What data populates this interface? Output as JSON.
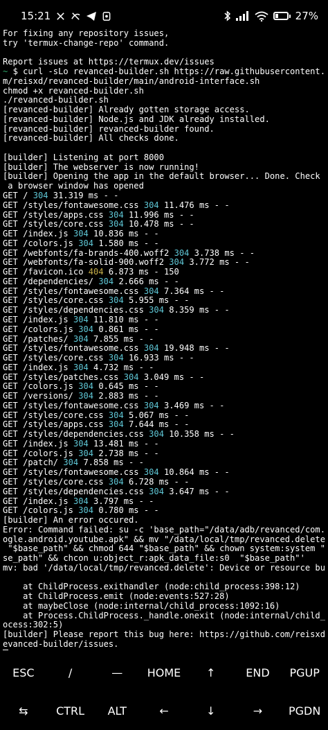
{
  "status_bar": {
    "time": "15:21",
    "battery_percent": "27%",
    "battery_level": 0.27
  },
  "terminal": {
    "lines": [
      [
        {
          "t": "For fixing any repository issues,"
        }
      ],
      [
        {
          "t": "try 'termux-change-repo' command."
        }
      ],
      [
        {
          "t": ""
        }
      ],
      [
        {
          "t": "Report issues at https://termux.dev/issues"
        }
      ],
      [
        {
          "t": "~ ",
          "c": "green"
        },
        {
          "t": "$ curl -sLo revanced-builder.sh https://raw.githubusercontent.co"
        }
      ],
      [
        {
          "t": "m/reisxd/revanced-builder/main/android-interface.sh"
        }
      ],
      [
        {
          "t": "chmod +x revanced-builder.sh"
        }
      ],
      [
        {
          "t": "./revanced-builder.sh"
        }
      ],
      [
        {
          "t": "[revanced-builder] Already gotten storage access."
        }
      ],
      [
        {
          "t": "[revanced-builder] Node.js and JDK already installed."
        }
      ],
      [
        {
          "t": "[revanced-builder] revanced-builder found."
        }
      ],
      [
        {
          "t": "[revanced-builder] All checks done."
        }
      ],
      [
        {
          "t": ""
        }
      ],
      [
        {
          "t": "[builder] Listening at port 8000"
        }
      ],
      [
        {
          "t": "[builder] The webserver is now running!"
        }
      ],
      [
        {
          "t": "[builder] Opening the app in the default browser... Done. Check if"
        }
      ],
      [
        {
          "t": " a browser window has opened"
        }
      ],
      [
        {
          "t": "GET / "
        },
        {
          "t": "304",
          "c": "cyan"
        },
        {
          "t": " 31.319 ms - -"
        }
      ],
      [
        {
          "t": "GET /styles/fontawesome.css "
        },
        {
          "t": "304",
          "c": "cyan"
        },
        {
          "t": " 11.476 ms - -"
        }
      ],
      [
        {
          "t": "GET /styles/apps.css "
        },
        {
          "t": "304",
          "c": "cyan"
        },
        {
          "t": " 11.996 ms - -"
        }
      ],
      [
        {
          "t": "GET /styles/core.css "
        },
        {
          "t": "304",
          "c": "cyan"
        },
        {
          "t": " 10.478 ms - -"
        }
      ],
      [
        {
          "t": "GET /index.js "
        },
        {
          "t": "304",
          "c": "cyan"
        },
        {
          "t": " 10.836 ms - -"
        }
      ],
      [
        {
          "t": "GET /colors.js "
        },
        {
          "t": "304",
          "c": "cyan"
        },
        {
          "t": " 1.580 ms - -"
        }
      ],
      [
        {
          "t": "GET /webfonts/fa-brands-400.woff2 "
        },
        {
          "t": "304",
          "c": "cyan"
        },
        {
          "t": " 3.738 ms - -"
        }
      ],
      [
        {
          "t": "GET /webfonts/fa-solid-900.woff2 "
        },
        {
          "t": "304",
          "c": "cyan"
        },
        {
          "t": " 3.772 ms - -"
        }
      ],
      [
        {
          "t": "GET /favicon.ico "
        },
        {
          "t": "404",
          "c": "yellow"
        },
        {
          "t": " 6.873 ms - 150"
        }
      ],
      [
        {
          "t": "GET /dependencies/ "
        },
        {
          "t": "304",
          "c": "cyan"
        },
        {
          "t": " 2.666 ms - -"
        }
      ],
      [
        {
          "t": "GET /styles/fontawesome.css "
        },
        {
          "t": "304",
          "c": "cyan"
        },
        {
          "t": " 7.364 ms - -"
        }
      ],
      [
        {
          "t": "GET /styles/core.css "
        },
        {
          "t": "304",
          "c": "cyan"
        },
        {
          "t": " 5.955 ms - -"
        }
      ],
      [
        {
          "t": "GET /styles/dependencies.css "
        },
        {
          "t": "304",
          "c": "cyan"
        },
        {
          "t": " 8.359 ms - -"
        }
      ],
      [
        {
          "t": "GET /index.js "
        },
        {
          "t": "304",
          "c": "cyan"
        },
        {
          "t": " 11.810 ms - -"
        }
      ],
      [
        {
          "t": "GET /colors.js "
        },
        {
          "t": "304",
          "c": "cyan"
        },
        {
          "t": " 0.861 ms - -"
        }
      ],
      [
        {
          "t": "GET /patches/ "
        },
        {
          "t": "304",
          "c": "cyan"
        },
        {
          "t": " 7.855 ms - -"
        }
      ],
      [
        {
          "t": "GET /styles/fontawesome.css "
        },
        {
          "t": "304",
          "c": "cyan"
        },
        {
          "t": " 19.948 ms - -"
        }
      ],
      [
        {
          "t": "GET /styles/core.css "
        },
        {
          "t": "304",
          "c": "cyan"
        },
        {
          "t": " 16.933 ms - -"
        }
      ],
      [
        {
          "t": "GET /index.js "
        },
        {
          "t": "304",
          "c": "cyan"
        },
        {
          "t": " 4.732 ms - -"
        }
      ],
      [
        {
          "t": "GET /styles/patches.css "
        },
        {
          "t": "304",
          "c": "cyan"
        },
        {
          "t": " 3.049 ms - -"
        }
      ],
      [
        {
          "t": "GET /colors.js "
        },
        {
          "t": "304",
          "c": "cyan"
        },
        {
          "t": " 0.645 ms - -"
        }
      ],
      [
        {
          "t": "GET /versions/ "
        },
        {
          "t": "304",
          "c": "cyan"
        },
        {
          "t": " 2.883 ms - -"
        }
      ],
      [
        {
          "t": "GET /styles/fontawesome.css "
        },
        {
          "t": "304",
          "c": "cyan"
        },
        {
          "t": " 3.469 ms - -"
        }
      ],
      [
        {
          "t": "GET /styles/core.css "
        },
        {
          "t": "304",
          "c": "cyan"
        },
        {
          "t": " 5.067 ms - -"
        }
      ],
      [
        {
          "t": "GET /styles/apps.css "
        },
        {
          "t": "304",
          "c": "cyan"
        },
        {
          "t": " 7.644 ms - -"
        }
      ],
      [
        {
          "t": "GET /styles/dependencies.css "
        },
        {
          "t": "304",
          "c": "cyan"
        },
        {
          "t": " 10.358 ms - -"
        }
      ],
      [
        {
          "t": "GET /index.js "
        },
        {
          "t": "304",
          "c": "cyan"
        },
        {
          "t": " 13.481 ms - -"
        }
      ],
      [
        {
          "t": "GET /colors.js "
        },
        {
          "t": "304",
          "c": "cyan"
        },
        {
          "t": " 2.738 ms - -"
        }
      ],
      [
        {
          "t": "GET /patch/ "
        },
        {
          "t": "304",
          "c": "cyan"
        },
        {
          "t": " 7.858 ms - -"
        }
      ],
      [
        {
          "t": "GET /styles/fontawesome.css "
        },
        {
          "t": "304",
          "c": "cyan"
        },
        {
          "t": " 10.864 ms - -"
        }
      ],
      [
        {
          "t": "GET /styles/core.css "
        },
        {
          "t": "304",
          "c": "cyan"
        },
        {
          "t": " 6.728 ms - -"
        }
      ],
      [
        {
          "t": "GET /styles/dependencies.css "
        },
        {
          "t": "304",
          "c": "cyan"
        },
        {
          "t": " 3.647 ms - -"
        }
      ],
      [
        {
          "t": "GET /index.js "
        },
        {
          "t": "304",
          "c": "cyan"
        },
        {
          "t": " 3.797 ms - -"
        }
      ],
      [
        {
          "t": "GET /colors.js "
        },
        {
          "t": "304",
          "c": "cyan"
        },
        {
          "t": " 0.780 ms - -"
        }
      ],
      [
        {
          "t": "[builder] An error occured."
        }
      ],
      [
        {
          "t": "Error: Command failed: su -c 'base_path=\"/data/adb/revanced/com.go"
        }
      ],
      [
        {
          "t": "ogle.android.youtube.apk\" && mv \"/data/local/tmp/revanced.delete\""
        }
      ],
      [
        {
          "t": " \"$base_path\" && chmod 644 \"$base_path\" && chown system:system \"$ba"
        }
      ],
      [
        {
          "t": "se_path\" && chcon u:object_r:apk_data_file:s0  \"$base_path\"'"
        }
      ],
      [
        {
          "t": "mv: bad '/data/local/tmp/revanced.delete': Device or resource busy"
        }
      ],
      [
        {
          "t": ""
        }
      ],
      [
        {
          "t": "    at ChildProcess.exithandler (node:child_process:398:12)"
        }
      ],
      [
        {
          "t": "    at ChildProcess.emit (node:events:527:28)"
        }
      ],
      [
        {
          "t": "    at maybeClose (node:internal/child_process:1092:16)"
        }
      ],
      [
        {
          "t": "    at Process.ChildProcess._handle.onexit (node:internal/child_pr"
        }
      ],
      [
        {
          "t": "ocess:302:5)"
        }
      ],
      [
        {
          "t": "[builder] Please report this bug here: https://github.com/reisxd/r"
        }
      ],
      [
        {
          "t": "evanced-builder/issues."
        }
      ]
    ]
  },
  "extra_keys": {
    "row1": [
      "ESC",
      "/",
      "—",
      "HOME",
      "↑",
      "END",
      "PGUP"
    ],
    "row2": [
      "⇆",
      "CTRL",
      "ALT",
      "←",
      "↓",
      "→",
      "PGDN"
    ]
  },
  "colors": {
    "background": "#000000",
    "foreground": "#ffffff",
    "status_304": "#5fc7d6",
    "status_404": "#c7b04a",
    "prompt": "#2ea86a"
  }
}
